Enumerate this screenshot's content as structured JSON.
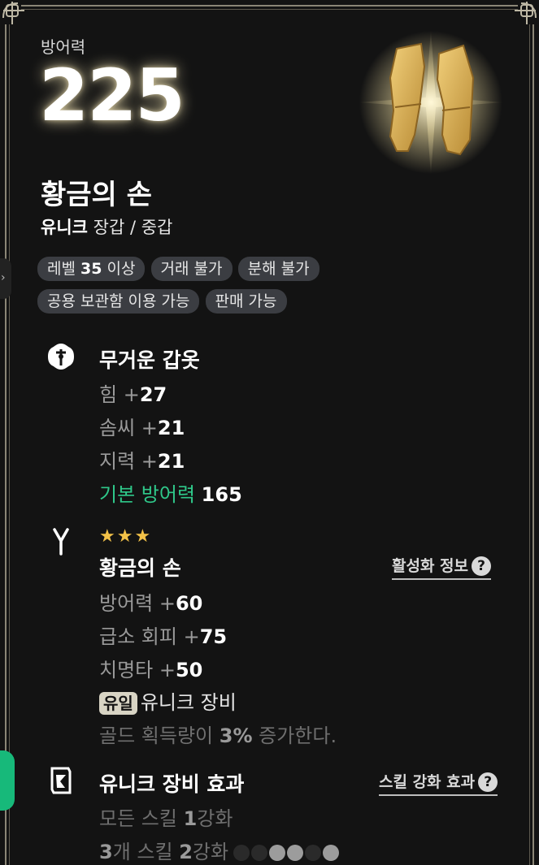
{
  "stat": {
    "label": "방어력",
    "value": "225"
  },
  "item": {
    "name": "황금의 손",
    "grade": "유니크",
    "type": "장갑 / 중갑"
  },
  "tags": {
    "level_prefix": "레벨 ",
    "level_value": "35",
    "level_suffix": " 이상",
    "trade": "거래 불가",
    "dismantle": "분해 불가",
    "storage": "공용 보관함 이용 가능",
    "sell": "판매 가능"
  },
  "set": {
    "icon": "heavy-armor-icon",
    "title": "무거운 갑옷",
    "lines": [
      {
        "label": "힘 +",
        "value": "27"
      },
      {
        "label": "솜씨 +",
        "value": "21"
      },
      {
        "label": "지력 +",
        "value": "21"
      }
    ],
    "base_label": "기본 방어력 ",
    "base_value": "165"
  },
  "rune": {
    "icon": "rune-icon",
    "stars": "★★★",
    "title": "황금의 손",
    "activation_link": "활성화 정보",
    "lines": [
      {
        "label": "방어력 +",
        "value": "60"
      },
      {
        "label": "급소 회피 +",
        "value": "75"
      },
      {
        "label": "치명타 +",
        "value": "50"
      }
    ],
    "unique_badge": "유일",
    "unique_label": "유니크 장비",
    "gold_prefix": "골드 획득량이 ",
    "gold_value": "3%",
    "gold_suffix": " 증가한다."
  },
  "unique_effect": {
    "icon": "scroll-icon",
    "title": "유니크 장비 효과",
    "skill_link": "스킬 강화 효과",
    "line1_prefix": "모든 스킬 ",
    "line1_value": "1",
    "line1_suffix": "강화",
    "line2_count": "3",
    "line2_mid": "개 스킬 ",
    "line2_value": "2",
    "line2_suffix": "강화",
    "dots": [
      "#2a2a2a",
      "#2a2a2a",
      "#9c9c9c",
      "#9c9c9c",
      "#2a2a2a",
      "#9c9c9c"
    ]
  },
  "colors": {
    "accent_green": "#2fc88a",
    "star_gold": "#f3c248",
    "tag_bg": "#3b3d42"
  }
}
